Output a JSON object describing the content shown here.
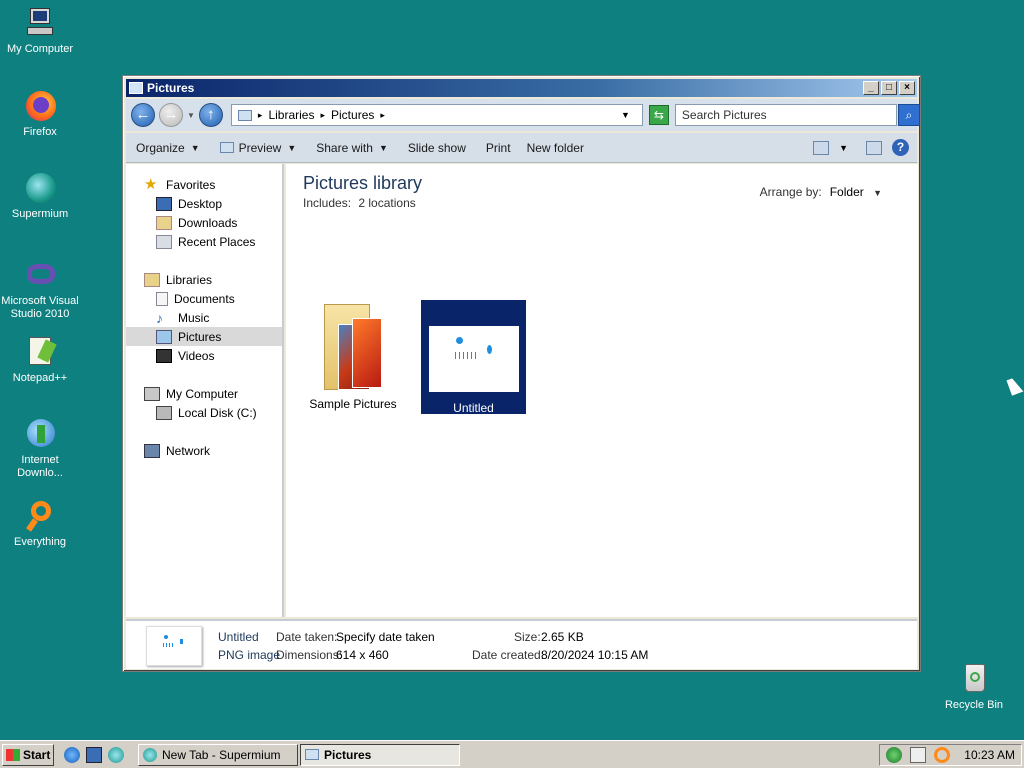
{
  "desktop": {
    "icons": [
      {
        "label": "My Computer",
        "icon": "computer-icon"
      },
      {
        "label": "Firefox",
        "icon": "firefox-icon"
      },
      {
        "label": "Supermium",
        "icon": "supermium-icon"
      },
      {
        "label": "Microsoft Visual Studio 2010",
        "icon": "visual-studio-icon"
      },
      {
        "label": "Notepad++",
        "icon": "notepad-plus-plus-icon"
      },
      {
        "label": "Internet Downlo...",
        "icon": "internet-download-manager-icon"
      },
      {
        "label": "Everything",
        "icon": "everything-search-icon"
      },
      {
        "label": "Recycle Bin",
        "icon": "recycle-bin-icon"
      }
    ]
  },
  "window": {
    "title": "Pictures",
    "controls": {
      "minimize": "_",
      "maximize": "□",
      "close": "×"
    },
    "address": {
      "root": "Libraries",
      "current": "Pictures",
      "sep": "▸"
    },
    "search_placeholder": "Search Pictures",
    "commands": [
      "Organize",
      "Preview",
      "Share with",
      "Slide show",
      "Print",
      "New folder"
    ],
    "nav": {
      "favorites": {
        "label": "Favorites",
        "items": [
          "Desktop",
          "Downloads",
          "Recent Places"
        ]
      },
      "libraries": {
        "label": "Libraries",
        "items": [
          "Documents",
          "Music",
          "Pictures",
          "Videos"
        ]
      },
      "computer": {
        "label": "My Computer",
        "items": [
          "Local Disk (C:)"
        ]
      },
      "network": {
        "label": "Network"
      }
    },
    "content": {
      "title": "Pictures library",
      "includes_label": "Includes:",
      "includes_value": "2 locations",
      "arrange_label": "Arrange by:",
      "arrange_value": "Folder",
      "files": [
        {
          "name": "Sample Pictures",
          "selected": false
        },
        {
          "name": "Untitled",
          "selected": true
        }
      ]
    },
    "details": {
      "name": "Untitled",
      "type": "PNG image",
      "date_taken_label": "Date taken:",
      "date_taken_value": "Specify date taken",
      "dimensions_label": "Dimensions:",
      "dimensions_value": "614 x 460",
      "size_label": "Size:",
      "size_value": "2.65 KB",
      "date_created_label": "Date created:",
      "date_created_value": "8/20/2024 10:15 AM"
    }
  },
  "taskbar": {
    "start_label": "Start",
    "tasks": [
      {
        "label": "New Tab - Supermium",
        "active": false
      },
      {
        "label": "Pictures",
        "active": true
      }
    ],
    "clock": "10:23 AM"
  },
  "colors": {
    "desktop_bg": "#0f8080",
    "selection": "#0a246a",
    "title_start": "#0a246a"
  }
}
